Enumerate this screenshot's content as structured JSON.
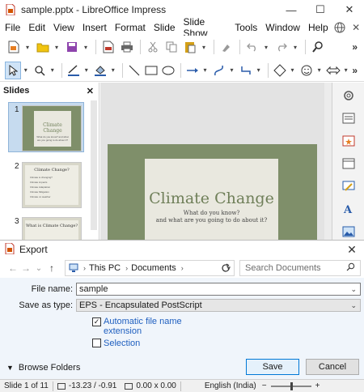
{
  "window": {
    "title": "sample.pptx - LibreOffice Impress",
    "minimize": "—",
    "maximize": "☐",
    "close": "✕"
  },
  "menubar": {
    "items": [
      "File",
      "Edit",
      "View",
      "Insert",
      "Format",
      "Slide",
      "Slide Show",
      "Tools",
      "Window",
      "Help"
    ],
    "more": "»"
  },
  "toolbars": {
    "more": "»"
  },
  "slides_panel": {
    "title": "Slides",
    "close": "✕",
    "thumbnails": [
      {
        "number": "1",
        "title": "Climate Change",
        "subtitle": "What do you know? and what are you going to do about it?"
      },
      {
        "number": "2",
        "title": "Climate Change?",
        "bullets": [
          "Climate is changing?",
          "Climate impacts",
          "Climate Adaptation",
          "Climate Mitigation",
          "Climate vs weather"
        ]
      },
      {
        "number": "3",
        "title": "What is Climate Change?"
      }
    ]
  },
  "main_slide": {
    "title": "Climate Change",
    "subtitle_line1": "What do you know?",
    "subtitle_line2": "and what are you going to do about it?"
  },
  "export_dialog": {
    "title": "Export",
    "close": "✕",
    "nav": {
      "back": "←",
      "forward": "→",
      "recent": "⌄",
      "up": "↑"
    },
    "address": [
      "This PC",
      "Documents"
    ],
    "search_placeholder": "Search Documents",
    "file_name_label": "File name:",
    "file_name_value": "sample",
    "save_as_type_label": "Save as type:",
    "save_as_type_value": "EPS - Encapsulated PostScript",
    "automatic_extension_label_line1": "Automatic file name",
    "automatic_extension_label_line2": "extension",
    "automatic_extension_checked": true,
    "selection_label": "Selection",
    "selection_checked": false,
    "browse_folders": "Browse Folders",
    "save_button": "Save",
    "cancel_button": "Cancel"
  },
  "statusbar": {
    "slide_info": "Slide 1 of 11",
    "position": "-13.23 / -0.91",
    "size": "0.00 x 0.00",
    "language": "English (India)",
    "zoom_minus": "−",
    "zoom_plus": "+"
  },
  "colors": {
    "accent": "#0078d7",
    "slide_background": "#7f8f6a",
    "slide_title": "#6f7f59",
    "selection": "#c6dbef"
  }
}
